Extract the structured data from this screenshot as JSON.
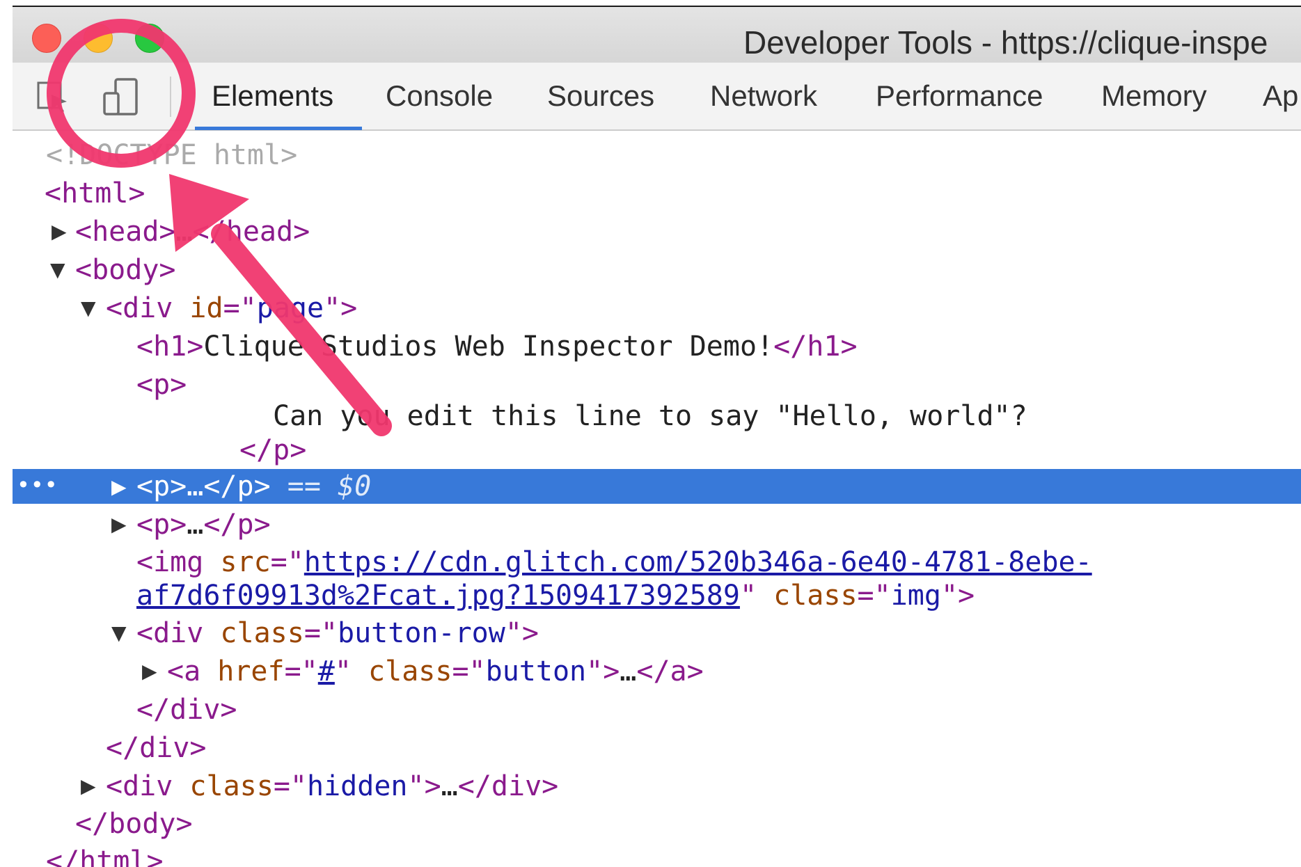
{
  "window": {
    "title": "Developer Tools - https://clique-inspe"
  },
  "toolbar": {
    "tabs": [
      {
        "label": "Elements"
      },
      {
        "label": "Console"
      },
      {
        "label": "Sources"
      },
      {
        "label": "Network"
      },
      {
        "label": "Performance"
      },
      {
        "label": "Memory"
      },
      {
        "label": "Ap"
      }
    ],
    "active_tab": "Elements",
    "icons": [
      "inspect-element-icon",
      "device-toolbar-icon"
    ]
  },
  "dom_tree": {
    "doctype": "<!DOCTYPE html>",
    "html_open": "<html>",
    "head": {
      "open": "<head>",
      "ellipsis": "…",
      "close": "</head>"
    },
    "body_open": "<body>",
    "div_page": {
      "tag": "<div",
      "attr_name": " id",
      "eq": "=\"",
      "attr_value": "page",
      "end": "\">"
    },
    "h1": {
      "open": "<h1>",
      "text": "Clique Studios Web Inspector Demo!",
      "close": "</h1>"
    },
    "p1": {
      "open": "<p>",
      "text": "Can you edit this line to say \"Hello, world\"?",
      "close": "</p>"
    },
    "selected_p": {
      "open": "<p>",
      "ellipsis": "…",
      "close": "</p>",
      "marker": " == $0"
    },
    "p3": {
      "open": "<p>",
      "ellipsis": "…",
      "close": "</p>"
    },
    "img": {
      "tag": "<img",
      "src_name": " src",
      "eq": "=\"",
      "src_line1": "https://cdn.glitch.com/520b346a-6e40-4781-8ebe-",
      "src_line2": "af7d6f09913d%2Fcat.jpg?1509417392589",
      "quote_close": "\"",
      "class_name": " class",
      "class_eq": "=\"",
      "class_value": "img",
      "end": "\">"
    },
    "div_button_row": {
      "tag": "<div",
      "attr_name": " class",
      "eq": "=\"",
      "attr_value": "button-row",
      "end": "\">"
    },
    "a_button": {
      "tag": "<a",
      "href_name": " href",
      "href_eq": "=\"",
      "href_value": "#",
      "href_q": "\"",
      "class_name": " class",
      "class_eq": "=\"",
      "class_value": "button",
      "end": "\">",
      "ellipsis": "…",
      "close": "</a>"
    },
    "div_close_inner": "</div>",
    "div_close_page": "</div>",
    "div_hidden": {
      "tag": "<div",
      "attr_name": " class",
      "eq": "=\"",
      "attr_value": "hidden",
      "end": "\">",
      "ellipsis": "…",
      "close": "</div>"
    },
    "body_close": "</body>",
    "html_close": "</html>"
  },
  "selection": {
    "dots": "•••",
    "color": "#3879d9"
  },
  "annotation": {
    "color": "#f0376e",
    "target": "device-toolbar-icon"
  }
}
